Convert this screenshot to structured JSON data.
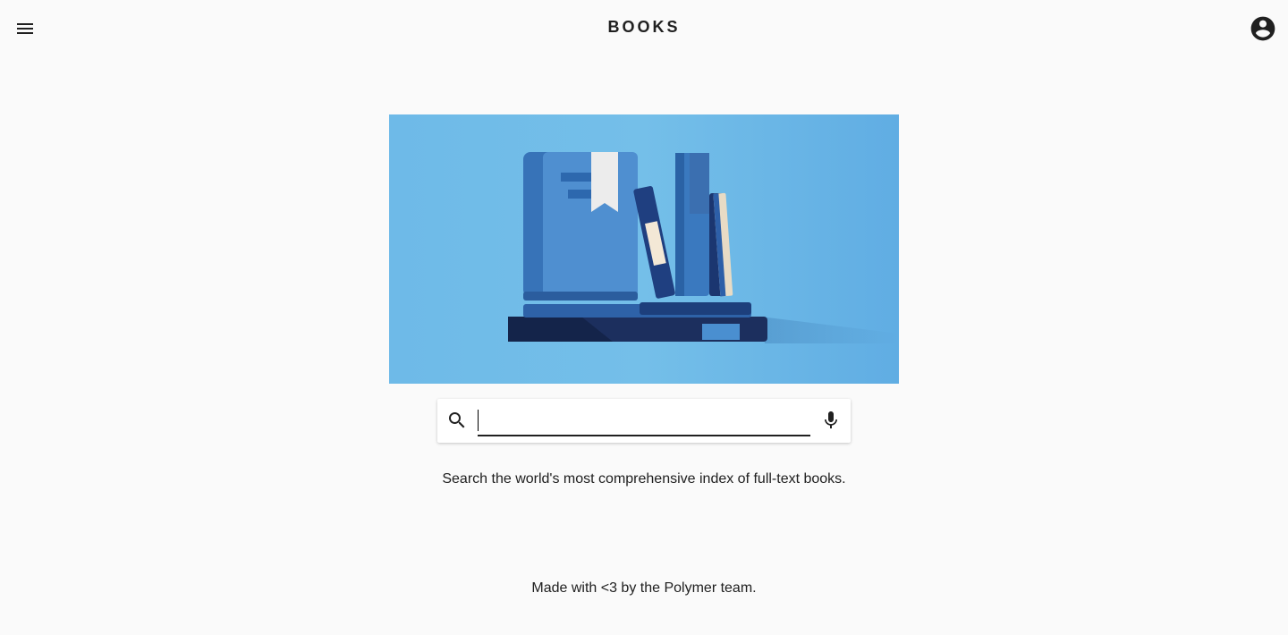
{
  "header": {
    "title": "BOOKS",
    "menu_icon": "menu-icon",
    "account_icon": "account-circle-icon"
  },
  "hero": {
    "illustration": "books-illustration",
    "background_color": "#6cb8e6"
  },
  "search": {
    "value": "",
    "placeholder": "",
    "search_icon": "search-icon",
    "mic_icon": "mic-icon"
  },
  "tagline": "Search the world's most comprehensive index of full-text books.",
  "footer": {
    "text": "Made with <3 by the Polymer team."
  }
}
